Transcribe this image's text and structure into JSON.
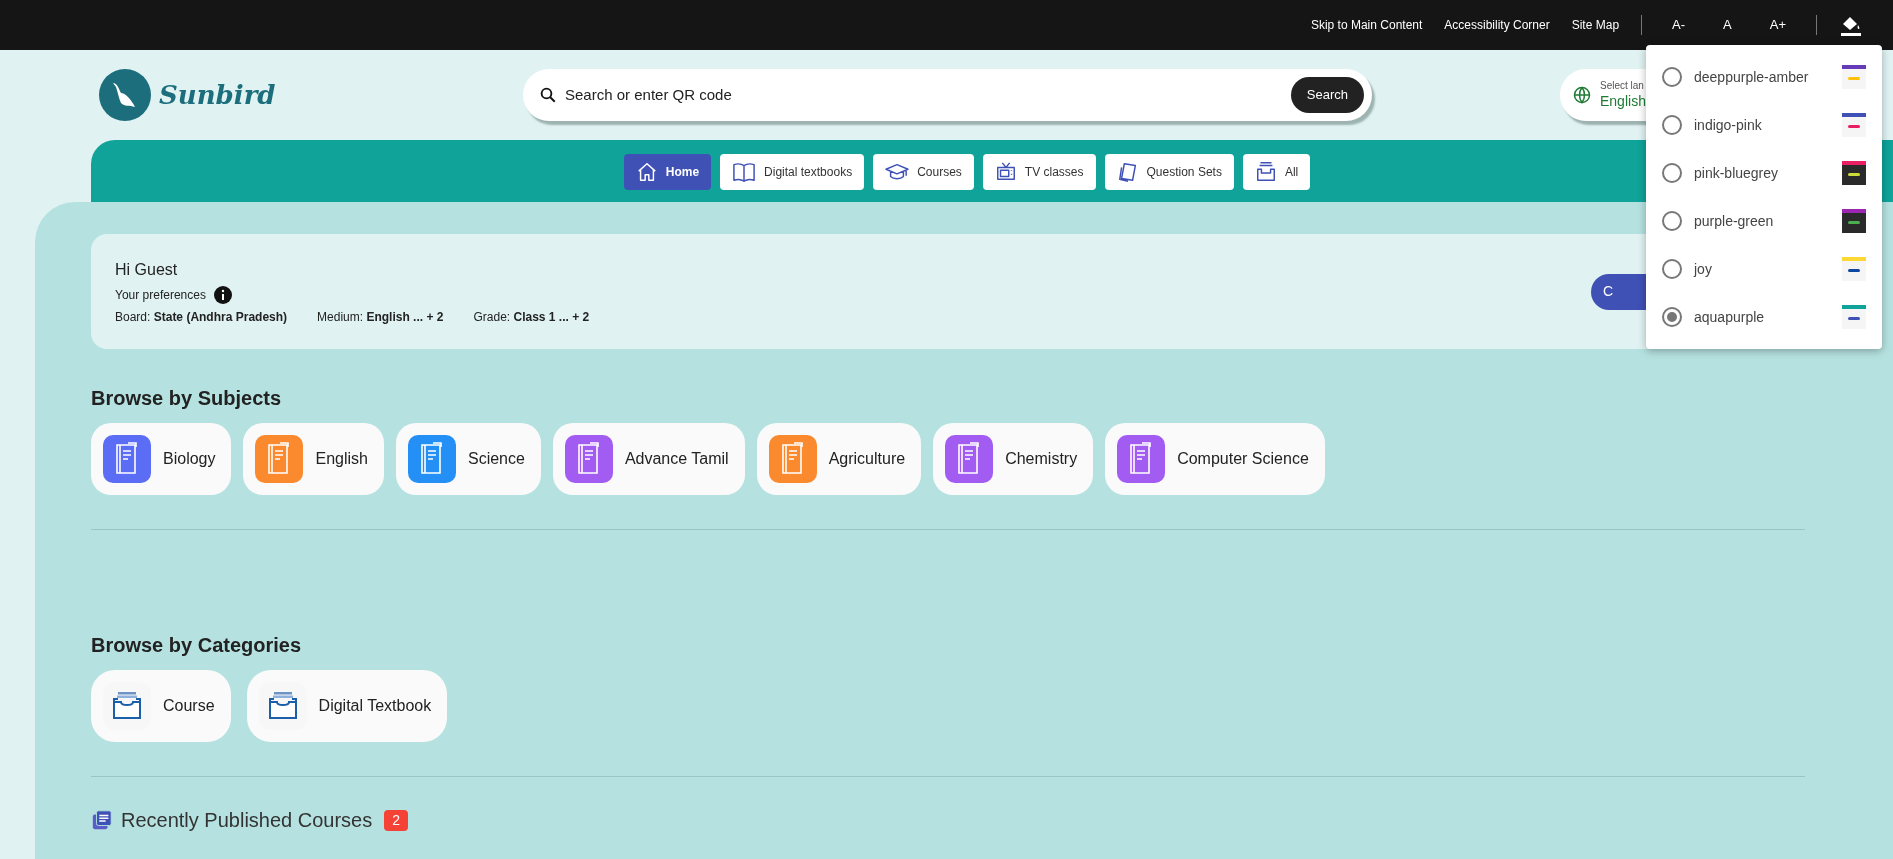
{
  "top_bar": {
    "links": [
      "Skip to Main Content",
      "Accessibility Corner",
      "Site Map"
    ],
    "font_sizes": [
      "A-",
      "A",
      "A+"
    ]
  },
  "header": {
    "logo_text": "Sunbird",
    "search": {
      "placeholder": "Search or enter QR code",
      "button": "Search"
    },
    "language": {
      "label": "Select lan",
      "value": "English"
    }
  },
  "nav_tabs": [
    {
      "label": "Home",
      "kind": "home",
      "selected": true
    },
    {
      "label": "Digital textbooks",
      "kind": "book",
      "selected": false
    },
    {
      "label": "Courses",
      "kind": "cap",
      "selected": false
    },
    {
      "label": "TV classes",
      "kind": "tv",
      "selected": false
    },
    {
      "label": "Question Sets",
      "kind": "papers",
      "selected": false
    },
    {
      "label": "All",
      "kind": "inbox",
      "selected": false
    }
  ],
  "preferences": {
    "greeting": "Hi Guest",
    "title": "Your preferences",
    "items": [
      {
        "label": "Board:",
        "value": "State (Andhra Pradesh)"
      },
      {
        "label": "Medium:",
        "value": "English ... + 2"
      },
      {
        "label": "Grade:",
        "value": "Class 1 ... + 2"
      }
    ],
    "button": "C"
  },
  "subjects": {
    "title": "Browse by Subjects",
    "items": [
      {
        "label": "Biology",
        "color": "#5b6cf5"
      },
      {
        "label": "English",
        "color": "#fb8a2e"
      },
      {
        "label": "Science",
        "color": "#2490f5"
      },
      {
        "label": "Advance Tamil",
        "color": "#a35cf2"
      },
      {
        "label": "Agriculture",
        "color": "#fb8a2e"
      },
      {
        "label": "Chemistry",
        "color": "#a35cf2"
      },
      {
        "label": "Computer Science",
        "color": "#a35cf2"
      }
    ]
  },
  "categories": {
    "title": "Browse by Categories",
    "items": [
      "Course",
      "Digital Textbook"
    ]
  },
  "recent": {
    "title": "Recently Published Courses",
    "count": "2"
  },
  "theme_menu": [
    {
      "label": "deeppurple-amber",
      "selected": false,
      "color": "#673ab7",
      "accent": {
        "color": "#ffc107"
      },
      "dark": false
    },
    {
      "label": "indigo-pink",
      "selected": false,
      "color": "#3f51b5",
      "accent": {
        "color": "#e91e63"
      },
      "dark": false
    },
    {
      "label": "pink-bluegrey",
      "selected": false,
      "color": "#e91e63",
      "accent": {
        "color": "#cddc39"
      },
      "dark": true
    },
    {
      "label": "purple-green",
      "selected": false,
      "color": "#9c27b0",
      "accent": {
        "color": "#4caf50"
      },
      "dark": true
    },
    {
      "label": "joy",
      "selected": false,
      "color": "#fdd835",
      "accent": {
        "color": "#0d47a1"
      },
      "dark": false
    },
    {
      "label": "aquapurple",
      "selected": true,
      "color": "#0fa39a",
      "accent": {
        "color": "#3f51b5"
      },
      "dark": false
    }
  ]
}
